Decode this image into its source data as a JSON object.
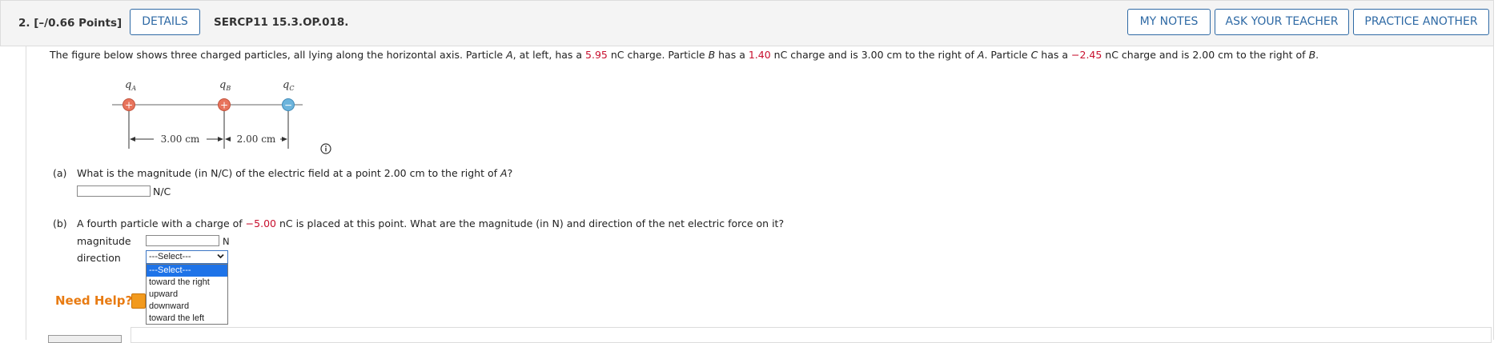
{
  "header": {
    "question_number": "2.",
    "points": "[–/0.66 Points]",
    "details_label": "DETAILS",
    "question_id": "SERCP11 15.3.OP.018.",
    "my_notes_label": "MY NOTES",
    "ask_teacher_label": "ASK YOUR TEACHER",
    "practice_label": "PRACTICE ANOTHER"
  },
  "intro": {
    "t1": "The figure below shows three charged particles, all lying along the horizontal axis. Particle ",
    "A": "A",
    "t2": ", at left, has a ",
    "qA": "5.95",
    "t3": " nC charge. Particle ",
    "B": "B",
    "t4": " has a ",
    "qB": "1.40",
    "t5": " nC charge and is 3.00 cm to the right of ",
    "A2": "A",
    "t6": ". Particle ",
    "C": "C",
    "t7": " has a ",
    "qC": "−2.45",
    "t8": " nC charge and is 2.00 cm to the right of ",
    "B2": "B",
    "t9": "."
  },
  "figure": {
    "labels": {
      "qA": "q",
      "qA_sub": "A",
      "qB": "q",
      "qB_sub": "B",
      "qC": "q",
      "qC_sub": "C"
    },
    "dim1": "3.00 cm",
    "dim2": "2.00 cm",
    "plus": "+",
    "minus": "−",
    "colors": {
      "positive": "#e8745c",
      "negative": "#6cb4dc"
    }
  },
  "part_a": {
    "label": "(a)",
    "q1": "What is the magnitude (in N/C) of the electric field at a point 2.00 cm to the right of ",
    "A": "A",
    "q2": "?",
    "unit": "N/C",
    "value": ""
  },
  "part_b": {
    "label": "(b)",
    "q1": "A fourth particle with a charge of ",
    "charge": "−5.00",
    "q2": " nC is placed at this point. What are the magnitude (in N) and direction of the net electric force on it?",
    "magnitude_label": "magnitude",
    "magnitude_unit": "N",
    "magnitude_value": "",
    "direction_label": "direction",
    "selected": "---Select---",
    "options": [
      "---Select---",
      "toward the right",
      "upward",
      "downward",
      "toward the left"
    ]
  },
  "help": {
    "label": "Need Help?"
  }
}
